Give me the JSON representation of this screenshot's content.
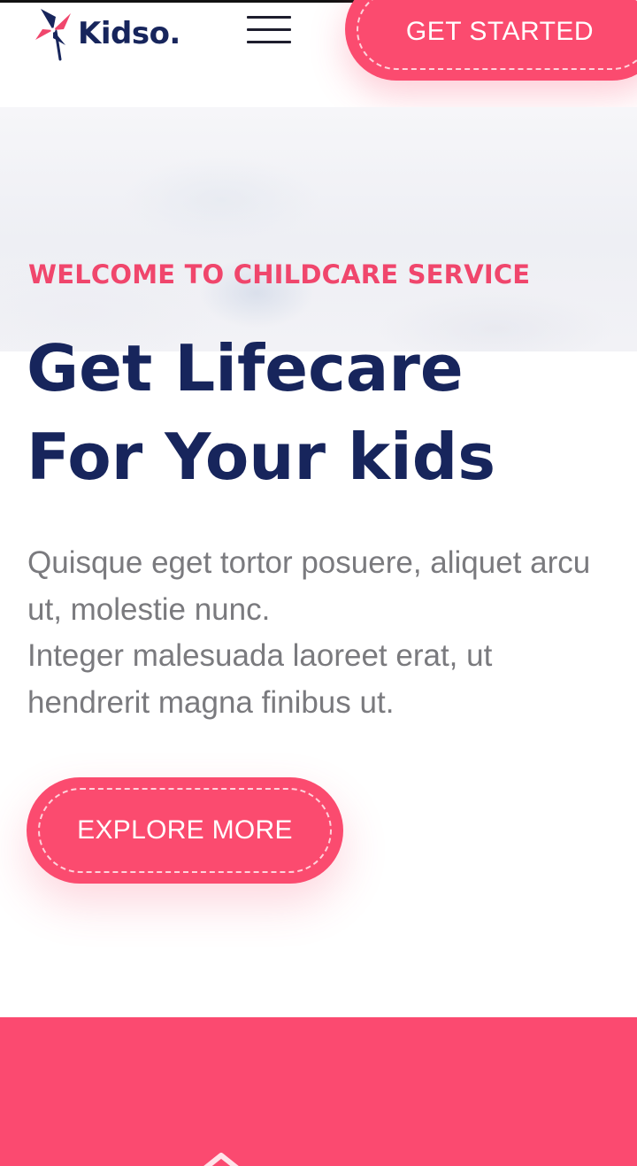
{
  "header": {
    "logo_text": "Kidso.",
    "logo_icon": "pinwheel-icon",
    "menu_icon": "hamburger-menu-icon",
    "cta_label": "GET STARTED"
  },
  "hero": {
    "eyebrow": "WELCOME TO CHILDCARE SERVICE",
    "headline_line1": "Get Lifecare",
    "headline_line2": "For Your kids",
    "description_lines": [
      "Quisque eget tortor posuere, aliquet arcu",
      "ut, molestie nunc.",
      "Integer malesuada laoreet erat, ut",
      "hendrerit magna finibus ut."
    ],
    "cta_label": "EXPLORE MORE"
  },
  "section_below": {
    "icon": "home-shape-icon"
  },
  "colors": {
    "accent": "#fb4b6f",
    "heading": "#17255c",
    "body_text": "#7a7a7e"
  }
}
